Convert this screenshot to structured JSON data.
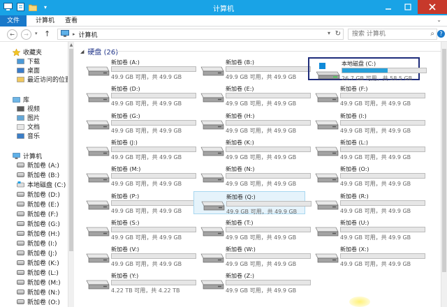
{
  "window": {
    "title": "计算机"
  },
  "ribbon": {
    "tabs": [
      "文件",
      "计算机",
      "查看"
    ]
  },
  "address": {
    "crumb": "计算机",
    "search_placeholder": "搜索 计算机"
  },
  "sidebar": {
    "favorites": {
      "label": "收藏夹",
      "items": [
        "下载",
        "桌面",
        "最近访问的位置"
      ]
    },
    "library": {
      "label": "库",
      "items": [
        "视频",
        "图片",
        "文档",
        "音乐"
      ]
    },
    "computer": {
      "label": "计算机",
      "items": [
        "新加卷 (A:)",
        "新加卷 (B:)",
        "本地磁盘 (C:)",
        "新加卷 (D:)",
        "新加卷 (E:)",
        "新加卷 (F:)",
        "新加卷 (G:)",
        "新加卷 (H:)",
        "新加卷 (I:)",
        "新加卷 (J:)",
        "新加卷 (K:)",
        "新加卷 (L:)",
        "新加卷 (M:)",
        "新加卷 (N:)",
        "新加卷 (O:)"
      ]
    }
  },
  "group": {
    "title": "硬盘 (26)"
  },
  "drives": [
    {
      "name": "新加卷 (A:)",
      "info": "49.9 GB 可用，共 49.9 GB",
      "used": 0
    },
    {
      "name": "新加卷 (B:)",
      "info": "49.9 GB 可用，共 49.9 GB",
      "used": 0
    },
    {
      "name": "本地磁盘 (C:)",
      "info": "26.7 GB 可用，共 58.5 GB",
      "used": 0.54
    },
    {
      "name": "新加卷 (D:)",
      "info": "49.9 GB 可用，共 49.9 GB",
      "used": 0
    },
    {
      "name": "新加卷 (E:)",
      "info": "49.9 GB 可用，共 49.9 GB",
      "used": 0
    },
    {
      "name": "新加卷 (F:)",
      "info": "49.9 GB 可用，共 49.9 GB",
      "used": 0
    },
    {
      "name": "新加卷 (G:)",
      "info": "49.9 GB 可用，共 49.9 GB",
      "used": 0
    },
    {
      "name": "新加卷 (H:)",
      "info": "49.9 GB 可用，共 49.9 GB",
      "used": 0
    },
    {
      "name": "新加卷 (I:)",
      "info": "49.9 GB 可用，共 49.9 GB",
      "used": 0
    },
    {
      "name": "新加卷 (J:)",
      "info": "49.9 GB 可用，共 49.9 GB",
      "used": 0
    },
    {
      "name": "新加卷 (K:)",
      "info": "49.9 GB 可用，共 49.9 GB",
      "used": 0
    },
    {
      "name": "新加卷 (L:)",
      "info": "49.9 GB 可用，共 49.9 GB",
      "used": 0
    },
    {
      "name": "新加卷 (M:)",
      "info": "49.9 GB 可用，共 49.9 GB",
      "used": 0
    },
    {
      "name": "新加卷 (N:)",
      "info": "49.9 GB 可用，共 49.9 GB",
      "used": 0
    },
    {
      "name": "新加卷 (O:)",
      "info": "49.9 GB 可用，共 49.9 GB",
      "used": 0
    },
    {
      "name": "新加卷 (P:)",
      "info": "49.9 GB 可用，共 49.9 GB",
      "used": 0
    },
    {
      "name": "新加卷 (Q:)",
      "info": "49.9 GB 可用，共 49.9 GB",
      "used": 0
    },
    {
      "name": "新加卷 (R:)",
      "info": "49.9 GB 可用，共 49.9 GB",
      "used": 0
    },
    {
      "name": "新加卷 (S:)",
      "info": "49.9 GB 可用，共 49.9 GB",
      "used": 0
    },
    {
      "name": "新加卷 (T:)",
      "info": "49.9 GB 可用，共 49.9 GB",
      "used": 0
    },
    {
      "name": "新加卷 (U:)",
      "info": "49.9 GB 可用，共 49.9 GB",
      "used": 0
    },
    {
      "name": "新加卷 (V:)",
      "info": "49.9 GB 可用，共 49.9 GB",
      "used": 0
    },
    {
      "name": "新加卷 (W:)",
      "info": "49.9 GB 可用，共 49.9 GB",
      "used": 0
    },
    {
      "name": "新加卷 (X:)",
      "info": "49.9 GB 可用，共 49.9 GB",
      "used": 0
    },
    {
      "name": "新加卷 (Y:)",
      "info": "4.22 TB 可用，共 4.22 TB",
      "used": 0
    },
    {
      "name": "新加卷 (Z:)",
      "info": "49.9 GB 可用，共 49.9 GB",
      "used": 0
    }
  ],
  "colors": {
    "titlebar": "#19a3e6",
    "file_tab": "#1979ca",
    "usage_fill": "#26a0da",
    "focus_border": "#1f2c7a"
  }
}
